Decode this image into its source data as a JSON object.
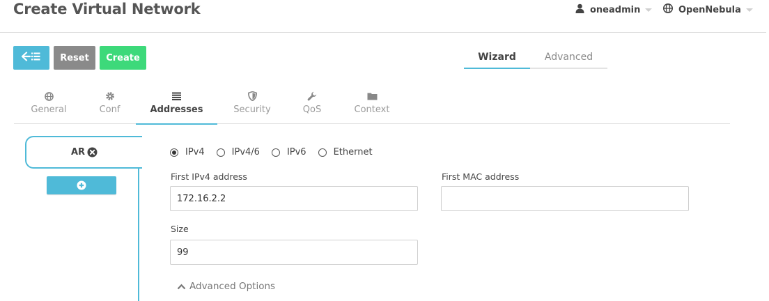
{
  "header": {
    "title": "Create Virtual Network",
    "user": "oneadmin",
    "zone": "OpenNebula"
  },
  "actions": {
    "back_icon": "back-list-icon",
    "reset_label": "Reset",
    "create_label": "Create"
  },
  "modes": {
    "wizard": "Wizard",
    "advanced": "Advanced",
    "active": "Wizard"
  },
  "tabs": [
    {
      "label": "General",
      "icon": "globe-icon"
    },
    {
      "label": "Conf",
      "icon": "gear-icon"
    },
    {
      "label": "Addresses",
      "icon": "list-icon"
    },
    {
      "label": "Security",
      "icon": "shield-icon"
    },
    {
      "label": "QoS",
      "icon": "wrench-icon"
    },
    {
      "label": "Context",
      "icon": "folder-icon"
    }
  ],
  "active_tab": "Addresses",
  "address_ranges": {
    "items": [
      {
        "label": "AR"
      }
    ]
  },
  "form": {
    "types": [
      {
        "label": "IPv4",
        "selected": true
      },
      {
        "label": "IPv4/6",
        "selected": false
      },
      {
        "label": "IPv6",
        "selected": false
      },
      {
        "label": "Ethernet",
        "selected": false
      }
    ],
    "first_ip_label": "First IPv4 address",
    "first_ip_value": "172.16.2.2",
    "first_mac_label": "First MAC address",
    "first_mac_value": "",
    "size_label": "Size",
    "size_value": "99",
    "advanced_options": "Advanced Options"
  },
  "colors": {
    "accent": "#4fbad8",
    "reset": "#8a8a8a",
    "create": "#3dd97a"
  }
}
